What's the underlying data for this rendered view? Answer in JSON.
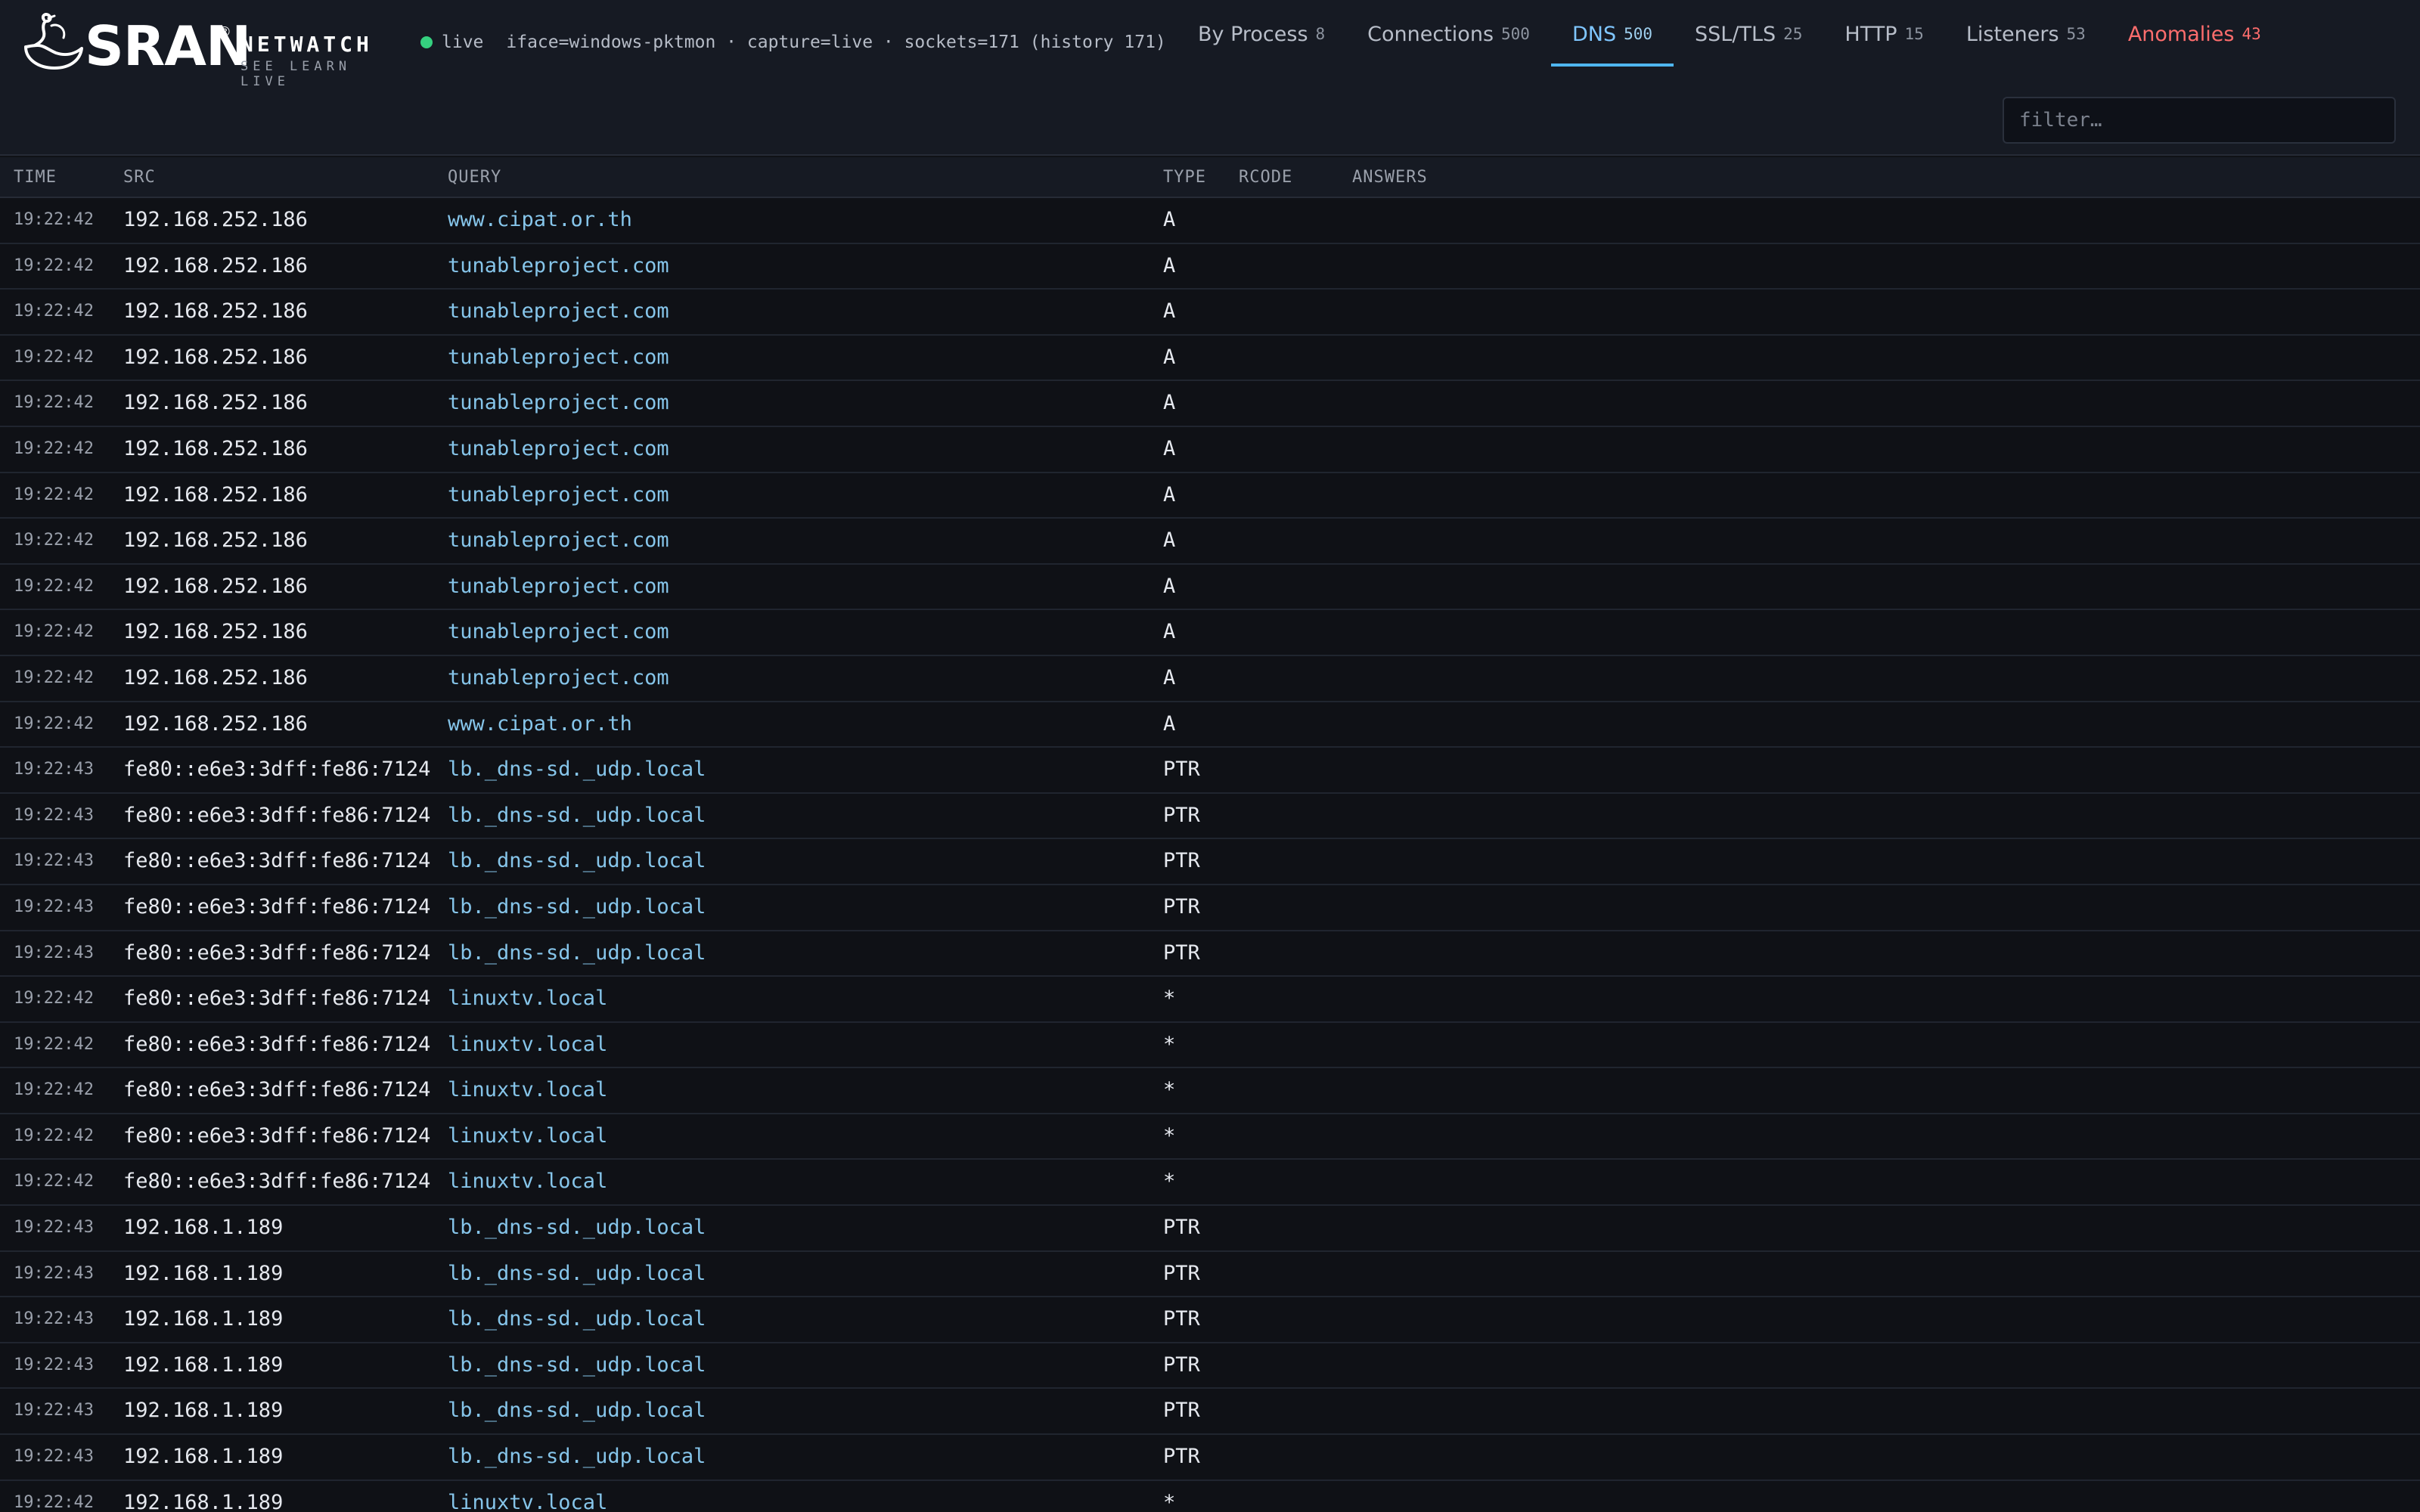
{
  "brand": {
    "name": "SRAN",
    "registered": "®",
    "product": "NETWATCH",
    "tagline": "SEE LEARN LIVE"
  },
  "status": {
    "live_label": "live",
    "details": "iface=windows-pktmon · capture=live · sockets=171 (history 171)"
  },
  "tabs": [
    {
      "label": "By Process",
      "count": "8"
    },
    {
      "label": "Connections",
      "count": "500"
    },
    {
      "label": "DNS",
      "count": "500"
    },
    {
      "label": "SSL/TLS",
      "count": "25"
    },
    {
      "label": "HTTP",
      "count": "15"
    },
    {
      "label": "Listeners",
      "count": "53"
    },
    {
      "label": "Anomalies",
      "count": "43"
    }
  ],
  "active_tab": "DNS",
  "filter": {
    "placeholder": "filter…",
    "value": ""
  },
  "columns": {
    "time": "TIME",
    "src": "SRC",
    "query": "QUERY",
    "type": "TYPE",
    "rcode": "RCODE",
    "answers": "ANSWERS"
  },
  "rows": [
    {
      "time": "19:22:42",
      "src": "192.168.252.186",
      "query": "www.cipat.or.th",
      "type": "A",
      "rcode": "",
      "answers": ""
    },
    {
      "time": "19:22:42",
      "src": "192.168.252.186",
      "query": "tunableproject.com",
      "type": "A",
      "rcode": "",
      "answers": ""
    },
    {
      "time": "19:22:42",
      "src": "192.168.252.186",
      "query": "tunableproject.com",
      "type": "A",
      "rcode": "",
      "answers": ""
    },
    {
      "time": "19:22:42",
      "src": "192.168.252.186",
      "query": "tunableproject.com",
      "type": "A",
      "rcode": "",
      "answers": ""
    },
    {
      "time": "19:22:42",
      "src": "192.168.252.186",
      "query": "tunableproject.com",
      "type": "A",
      "rcode": "",
      "answers": ""
    },
    {
      "time": "19:22:42",
      "src": "192.168.252.186",
      "query": "tunableproject.com",
      "type": "A",
      "rcode": "",
      "answers": ""
    },
    {
      "time": "19:22:42",
      "src": "192.168.252.186",
      "query": "tunableproject.com",
      "type": "A",
      "rcode": "",
      "answers": ""
    },
    {
      "time": "19:22:42",
      "src": "192.168.252.186",
      "query": "tunableproject.com",
      "type": "A",
      "rcode": "",
      "answers": ""
    },
    {
      "time": "19:22:42",
      "src": "192.168.252.186",
      "query": "tunableproject.com",
      "type": "A",
      "rcode": "",
      "answers": ""
    },
    {
      "time": "19:22:42",
      "src": "192.168.252.186",
      "query": "tunableproject.com",
      "type": "A",
      "rcode": "",
      "answers": ""
    },
    {
      "time": "19:22:42",
      "src": "192.168.252.186",
      "query": "tunableproject.com",
      "type": "A",
      "rcode": "",
      "answers": ""
    },
    {
      "time": "19:22:42",
      "src": "192.168.252.186",
      "query": "www.cipat.or.th",
      "type": "A",
      "rcode": "",
      "answers": ""
    },
    {
      "time": "19:22:43",
      "src": "fe80::e6e3:3dff:fe86:7124",
      "query": "lb._dns-sd._udp.local",
      "type": "PTR",
      "rcode": "",
      "answers": ""
    },
    {
      "time": "19:22:43",
      "src": "fe80::e6e3:3dff:fe86:7124",
      "query": "lb._dns-sd._udp.local",
      "type": "PTR",
      "rcode": "",
      "answers": ""
    },
    {
      "time": "19:22:43",
      "src": "fe80::e6e3:3dff:fe86:7124",
      "query": "lb._dns-sd._udp.local",
      "type": "PTR",
      "rcode": "",
      "answers": ""
    },
    {
      "time": "19:22:43",
      "src": "fe80::e6e3:3dff:fe86:7124",
      "query": "lb._dns-sd._udp.local",
      "type": "PTR",
      "rcode": "",
      "answers": ""
    },
    {
      "time": "19:22:43",
      "src": "fe80::e6e3:3dff:fe86:7124",
      "query": "lb._dns-sd._udp.local",
      "type": "PTR",
      "rcode": "",
      "answers": ""
    },
    {
      "time": "19:22:42",
      "src": "fe80::e6e3:3dff:fe86:7124",
      "query": "linuxtv.local",
      "type": "*",
      "rcode": "",
      "answers": ""
    },
    {
      "time": "19:22:42",
      "src": "fe80::e6e3:3dff:fe86:7124",
      "query": "linuxtv.local",
      "type": "*",
      "rcode": "",
      "answers": ""
    },
    {
      "time": "19:22:42",
      "src": "fe80::e6e3:3dff:fe86:7124",
      "query": "linuxtv.local",
      "type": "*",
      "rcode": "",
      "answers": ""
    },
    {
      "time": "19:22:42",
      "src": "fe80::e6e3:3dff:fe86:7124",
      "query": "linuxtv.local",
      "type": "*",
      "rcode": "",
      "answers": ""
    },
    {
      "time": "19:22:42",
      "src": "fe80::e6e3:3dff:fe86:7124",
      "query": "linuxtv.local",
      "type": "*",
      "rcode": "",
      "answers": ""
    },
    {
      "time": "19:22:43",
      "src": "192.168.1.189",
      "query": "lb._dns-sd._udp.local",
      "type": "PTR",
      "rcode": "",
      "answers": ""
    },
    {
      "time": "19:22:43",
      "src": "192.168.1.189",
      "query": "lb._dns-sd._udp.local",
      "type": "PTR",
      "rcode": "",
      "answers": ""
    },
    {
      "time": "19:22:43",
      "src": "192.168.1.189",
      "query": "lb._dns-sd._udp.local",
      "type": "PTR",
      "rcode": "",
      "answers": ""
    },
    {
      "time": "19:22:43",
      "src": "192.168.1.189",
      "query": "lb._dns-sd._udp.local",
      "type": "PTR",
      "rcode": "",
      "answers": ""
    },
    {
      "time": "19:22:43",
      "src": "192.168.1.189",
      "query": "lb._dns-sd._udp.local",
      "type": "PTR",
      "rcode": "",
      "answers": ""
    },
    {
      "time": "19:22:43",
      "src": "192.168.1.189",
      "query": "lb._dns-sd._udp.local",
      "type": "PTR",
      "rcode": "",
      "answers": ""
    },
    {
      "time": "19:22:42",
      "src": "192.168.1.189",
      "query": "linuxtv.local",
      "type": "*",
      "rcode": "",
      "answers": ""
    }
  ],
  "colors": {
    "accent": "#4fb6f0",
    "live": "#35d07f",
    "anomaly": "#ff6d6d",
    "query_text": "#86c5ea"
  },
  "icons": {
    "logo": "swan-logo-icon",
    "live_indicator": "live-dot-icon"
  }
}
